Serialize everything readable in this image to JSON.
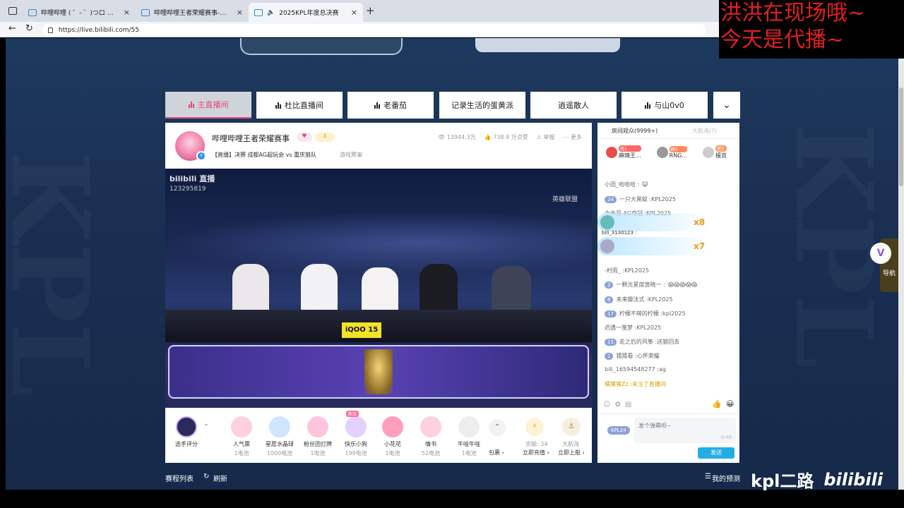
{
  "browser": {
    "tabs": [
      {
        "label": "哔哩哔哩 ( ゜- ゜)つロ 干杯~-bilib",
        "close": "×"
      },
      {
        "label": "哔哩哔哩王者荣耀赛事-哔哩哔哩",
        "close": "×"
      },
      {
        "label": "2025KPL年度总决赛",
        "close": "×"
      }
    ],
    "new_tab": "+",
    "url": "https://live.bilibili.com/55"
  },
  "overlay": {
    "line1": "洪洪在现场哦~",
    "line2": "今天是代播~"
  },
  "room_tabs": [
    {
      "label": "主直播间",
      "active": true,
      "bars": true
    },
    {
      "label": "杜比直播间",
      "bars": true
    },
    {
      "label": "老番茄",
      "bars": true
    },
    {
      "label": "记录生活的蛋黄派",
      "bars": false
    },
    {
      "label": "逍遥散人",
      "bars": false
    },
    {
      "label": "与山0v0",
      "bars": true
    }
  ],
  "room_more": "⌄",
  "streamer": {
    "name": "哔哩哔哩王者荣耀赛事",
    "title": "【直播】决赛 成都AG超玩会 vs 重庆狼队",
    "category": "游戏赛事",
    "views": "13944.3万",
    "likes": "738.9 万点赞",
    "report": "举报",
    "more": "更多"
  },
  "video": {
    "logo": "bilibili 直播",
    "room_id": "123295819",
    "corner": "英雄联盟"
  },
  "gifts": [
    {
      "name": "人气票",
      "price": "1电池"
    },
    {
      "name": "星愿水晶球",
      "price": "1000电池"
    },
    {
      "name": "粉丝团灯牌",
      "price": "1电池"
    },
    {
      "name": "快乐小狗",
      "price": "199电池"
    },
    {
      "name": "小花花",
      "price": "1电池"
    },
    {
      "name": "情书",
      "price": "52电池"
    },
    {
      "name": "牛哇牛哇",
      "price": "1电池"
    }
  ],
  "gift_extra": {
    "score_label": "选手评分",
    "pack": "包裹 ›",
    "balance": "余额: 34",
    "recharge": "立即充值 ›",
    "sail": "大航海",
    "board": "立即上船 ›",
    "new_badge": "新品"
  },
  "chat": {
    "tab_audience": "房间观众(9999+)",
    "tab_guard": "大航海(?)",
    "top_users": [
      {
        "rank": "榜1",
        "name": "麻辣王..."
      },
      {
        "rank": "榜2",
        "name": "RNG..."
      },
      {
        "rank": "榜3",
        "name": "檀苔"
      }
    ],
    "messages": [
      {
        "level": "",
        "text": "小团_哈哈哈 :"
      },
      {
        "level": "24",
        "text": "一只大黑蚁 :KPL2025"
      },
      {
        "level": "",
        "text": "今天是 AG夺冠 :KPL2025"
      },
      {
        "level": "",
        "text": "bili_3130123 :"
      },
      {
        "level": "",
        "text": "-村雨_ :KPL2025"
      },
      {
        "level": "2",
        "text": "一颗光星度悠晓一 :"
      },
      {
        "level": "6",
        "text": "未来瓣法式 :KPL2025"
      },
      {
        "level": "17",
        "text": "柠檬不萌的柠檬 :kpl2025"
      },
      {
        "level": "",
        "text": "迟遇一笺梦 :KPL2025"
      },
      {
        "level": "15",
        "text": "走之后的风筝 :送狼回去"
      },
      {
        "level": "1",
        "text": "猜猜看 :心怀荣耀"
      },
      {
        "level": "",
        "text": "bili_16594548277 :ag"
      },
      {
        "level": "",
        "text": "橘猪猪Zz :关注了直播间"
      }
    ],
    "combo1": "x8",
    "combo2": "x7",
    "input_placeholder": "发个弹幕呗~",
    "input_count": "0/40",
    "send": "发送",
    "medal": "KPL24"
  },
  "bottom": {
    "schedule": "赛程列表",
    "refresh": "刷新",
    "predict": "我的预测"
  },
  "side_nav": "导航",
  "watermark": {
    "a": "kpl二路",
    "b": "bilibili"
  },
  "colors": {
    "accent": "#e44a7a",
    "blue": "#23ade5"
  }
}
